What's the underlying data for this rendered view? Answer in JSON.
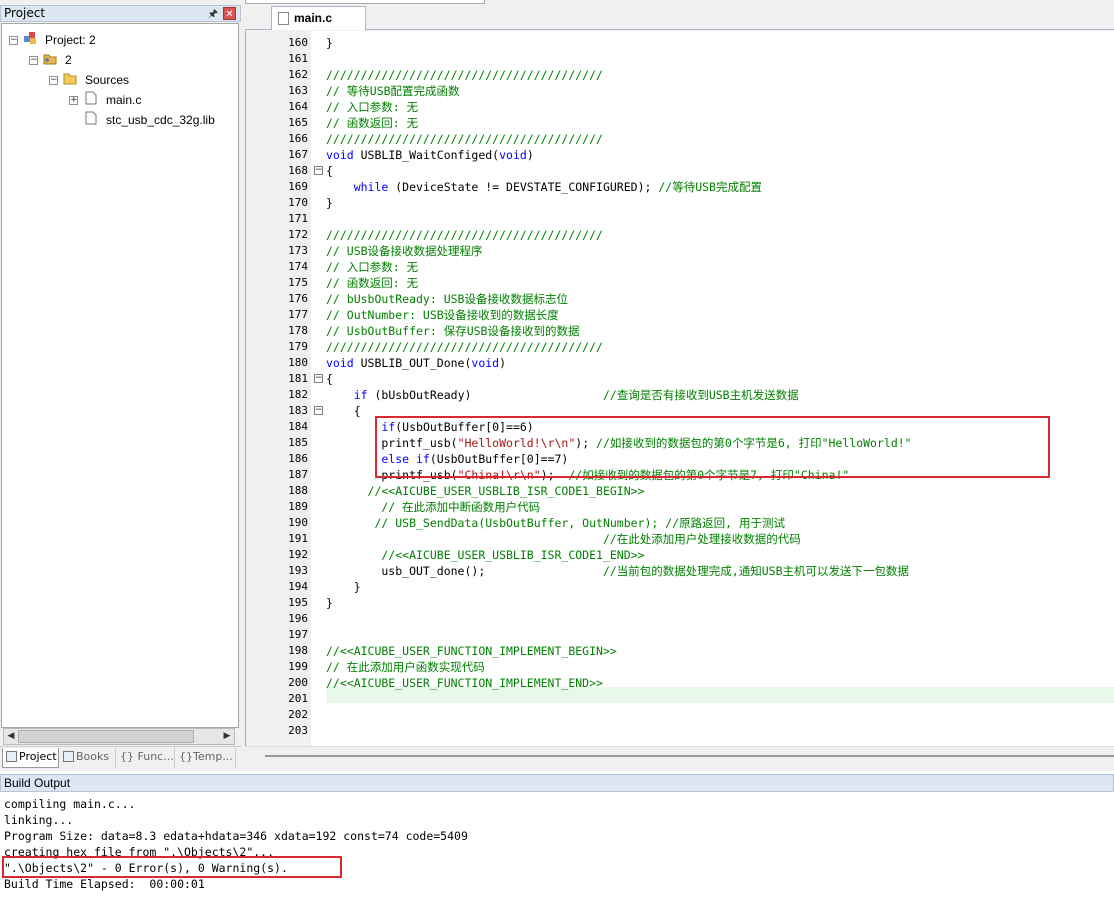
{
  "project_panel": {
    "title": "Project",
    "tree": {
      "root": "Project: 2",
      "target": "2",
      "group": "Sources",
      "files": [
        "main.c",
        "stc_usb_cdc_32g.lib"
      ]
    },
    "tabs": [
      "Project",
      "Books",
      "Func...",
      "Temp..."
    ]
  },
  "editor": {
    "active_tab": "main.c",
    "lines": [
      {
        "n": "160",
        "fold": "",
        "segs": [
          {
            "t": "}",
            "c": ""
          }
        ]
      },
      {
        "n": "161",
        "fold": "",
        "segs": []
      },
      {
        "n": "162",
        "fold": "",
        "segs": [
          {
            "t": "////////////////////////////////////////",
            "c": "cm"
          }
        ]
      },
      {
        "n": "163",
        "fold": "",
        "segs": [
          {
            "t": "// 等待USB配置完成函数",
            "c": "cm"
          }
        ]
      },
      {
        "n": "164",
        "fold": "",
        "segs": [
          {
            "t": "// 入口参数: 无",
            "c": "cm"
          }
        ]
      },
      {
        "n": "165",
        "fold": "",
        "segs": [
          {
            "t": "// 函数返回: 无",
            "c": "cm"
          }
        ]
      },
      {
        "n": "166",
        "fold": "",
        "segs": [
          {
            "t": "////////////////////////////////////////",
            "c": "cm"
          }
        ]
      },
      {
        "n": "167",
        "fold": "",
        "segs": [
          {
            "t": "void",
            "c": "kw"
          },
          {
            "t": " USBLIB_WaitConfiged(",
            "c": ""
          },
          {
            "t": "void",
            "c": "kw"
          },
          {
            "t": ")",
            "c": ""
          }
        ]
      },
      {
        "n": "168",
        "fold": "-",
        "segs": [
          {
            "t": "{",
            "c": ""
          }
        ]
      },
      {
        "n": "169",
        "fold": "",
        "segs": [
          {
            "t": "    ",
            "c": ""
          },
          {
            "t": "while",
            "c": "kw"
          },
          {
            "t": " (DeviceState != DEVSTATE_CONFIGURED); ",
            "c": ""
          },
          {
            "t": "//等待USB完成配置",
            "c": "cm"
          }
        ]
      },
      {
        "n": "170",
        "fold": "",
        "segs": [
          {
            "t": "}",
            "c": ""
          }
        ]
      },
      {
        "n": "171",
        "fold": "",
        "segs": []
      },
      {
        "n": "172",
        "fold": "",
        "segs": [
          {
            "t": "////////////////////////////////////////",
            "c": "cm"
          }
        ]
      },
      {
        "n": "173",
        "fold": "",
        "segs": [
          {
            "t": "// USB设备接收数据处理程序",
            "c": "cm"
          }
        ]
      },
      {
        "n": "174",
        "fold": "",
        "segs": [
          {
            "t": "// 入口参数: 无",
            "c": "cm"
          }
        ]
      },
      {
        "n": "175",
        "fold": "",
        "segs": [
          {
            "t": "// 函数返回: 无",
            "c": "cm"
          }
        ]
      },
      {
        "n": "176",
        "fold": "",
        "segs": [
          {
            "t": "// bUsbOutReady: USB设备接收数据标志位",
            "c": "cm"
          }
        ]
      },
      {
        "n": "177",
        "fold": "",
        "segs": [
          {
            "t": "// OutNumber: USB设备接收到的数据长度",
            "c": "cm"
          }
        ]
      },
      {
        "n": "178",
        "fold": "",
        "segs": [
          {
            "t": "// UsbOutBuffer: 保存USB设备接收到的数据",
            "c": "cm"
          }
        ]
      },
      {
        "n": "179",
        "fold": "",
        "segs": [
          {
            "t": "////////////////////////////////////////",
            "c": "cm"
          }
        ]
      },
      {
        "n": "180",
        "fold": "",
        "segs": [
          {
            "t": "void",
            "c": "kw"
          },
          {
            "t": " USBLIB_OUT_Done(",
            "c": ""
          },
          {
            "t": "void",
            "c": "kw"
          },
          {
            "t": ")",
            "c": ""
          }
        ]
      },
      {
        "n": "181",
        "fold": "-",
        "segs": [
          {
            "t": "{",
            "c": ""
          }
        ]
      },
      {
        "n": "182",
        "fold": "",
        "segs": [
          {
            "t": "    ",
            "c": ""
          },
          {
            "t": "if",
            "c": "kw"
          },
          {
            "t": " (bUsbOutReady)                   ",
            "c": ""
          },
          {
            "t": "//查询是否有接收到USB主机发送数据",
            "c": "cm"
          }
        ]
      },
      {
        "n": "183",
        "fold": "-",
        "segs": [
          {
            "t": "    {",
            "c": ""
          }
        ]
      },
      {
        "n": "184",
        "fold": "",
        "segs": [
          {
            "t": "        ",
            "c": ""
          },
          {
            "t": "if",
            "c": "kw"
          },
          {
            "t": "(UsbOutBuffer[0]==6)",
            "c": ""
          }
        ]
      },
      {
        "n": "185",
        "fold": "",
        "segs": [
          {
            "t": "        printf_usb(",
            "c": ""
          },
          {
            "t": "\"HelloWorld!\\r\\n\"",
            "c": "st"
          },
          {
            "t": "); ",
            "c": ""
          },
          {
            "t": "//如接收到的数据包的第0个字节是6, 打印\"HelloWorld!\"",
            "c": "cm"
          }
        ]
      },
      {
        "n": "186",
        "fold": "",
        "segs": [
          {
            "t": "        ",
            "c": ""
          },
          {
            "t": "else if",
            "c": "kw"
          },
          {
            "t": "(UsbOutBuffer[0]==7)",
            "c": ""
          }
        ]
      },
      {
        "n": "187",
        "fold": "",
        "segs": [
          {
            "t": "        printf_usb(",
            "c": ""
          },
          {
            "t": "\"China!\\r\\n\"",
            "c": "st"
          },
          {
            "t": ");  ",
            "c": ""
          },
          {
            "t": "//如接收到的数据包的第0个字节是7, 打印\"China!\"",
            "c": "cm"
          }
        ]
      },
      {
        "n": "188",
        "fold": "",
        "segs": [
          {
            "t": "      //<<AICUBE_USER_USBLIB_ISR_CODE1_BEGIN>>",
            "c": "cm"
          }
        ]
      },
      {
        "n": "189",
        "fold": "",
        "segs": [
          {
            "t": "        // 在此添加中断函数用户代码",
            "c": "cm"
          }
        ]
      },
      {
        "n": "190",
        "fold": "",
        "segs": [
          {
            "t": "       // USB_SendData(UsbOutBuffer, OutNumber); //原路返回, 用于测试",
            "c": "cm"
          }
        ]
      },
      {
        "n": "191",
        "fold": "",
        "segs": [
          {
            "t": "                                        //在此处添加用户处理接收数据的代码",
            "c": "cm"
          }
        ]
      },
      {
        "n": "192",
        "fold": "",
        "segs": [
          {
            "t": "        //<<AICUBE_USER_USBLIB_ISR_CODE1_END>>",
            "c": "cm"
          }
        ]
      },
      {
        "n": "193",
        "fold": "",
        "segs": [
          {
            "t": "        usb_OUT_done();                 ",
            "c": ""
          },
          {
            "t": "//当前包的数据处理完成,通知USB主机可以发送下一包数据",
            "c": "cm"
          }
        ]
      },
      {
        "n": "194",
        "fold": "",
        "segs": [
          {
            "t": "    }",
            "c": ""
          }
        ]
      },
      {
        "n": "195",
        "fold": "",
        "segs": [
          {
            "t": "}",
            "c": ""
          }
        ]
      },
      {
        "n": "196",
        "fold": "",
        "segs": []
      },
      {
        "n": "197",
        "fold": "",
        "segs": []
      },
      {
        "n": "198",
        "fold": "",
        "segs": [
          {
            "t": "//<<AICUBE_USER_FUNCTION_IMPLEMENT_BEGIN>>",
            "c": "cm"
          }
        ]
      },
      {
        "n": "199",
        "fold": "",
        "segs": [
          {
            "t": "// 在此添加用户函数实现代码",
            "c": "cm"
          }
        ]
      },
      {
        "n": "200",
        "fold": "",
        "segs": [
          {
            "t": "//<<AICUBE_USER_FUNCTION_IMPLEMENT_END>>",
            "c": "cm"
          }
        ]
      },
      {
        "n": "201",
        "fold": "",
        "segs": []
      },
      {
        "n": "202",
        "fold": "",
        "segs": []
      },
      {
        "n": "203",
        "fold": "",
        "segs": []
      }
    ]
  },
  "build_output": {
    "title": "Build Output",
    "lines": [
      "compiling main.c...",
      "linking...",
      "Program Size: data=8.3 edata+hdata=346 xdata=192 const=74 code=5409",
      "creating hex file from \".\\Objects\\2\"...",
      "\".\\Objects\\2\" - 0 Error(s), 0 Warning(s).",
      "Build Time Elapsed:  00:00:01"
    ]
  },
  "colors": {
    "keyword": "#0000ff",
    "comment": "#008000",
    "string": "#a31515",
    "highlight_box": "#d9282f",
    "current_line": "#e8f8ea"
  }
}
